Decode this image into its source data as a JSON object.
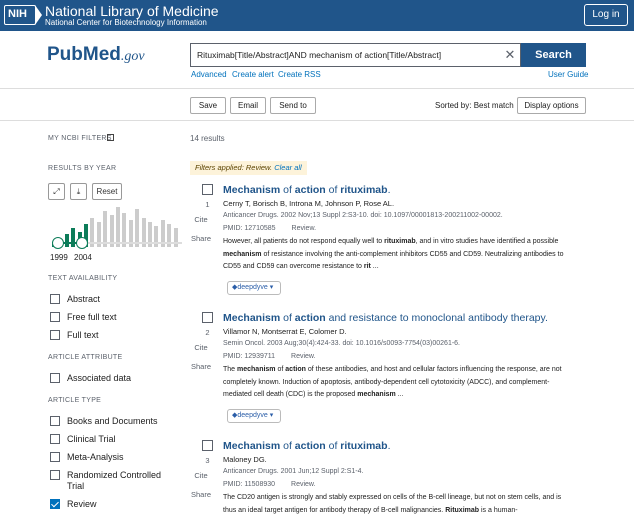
{
  "header": {
    "logo": "NIH",
    "org_name": "National Library of Medicine",
    "org_sub": "National Center for Biotechnology Information",
    "login": "Log in"
  },
  "brand": {
    "pub": "Pub",
    "med": "Med",
    "gov": ".gov"
  },
  "search": {
    "query": "Rituximab[Title/Abstract]AND mechanism of action[Title/Abstract]",
    "button": "Search",
    "clear_icon": "close-icon",
    "links": {
      "advanced": "Advanced",
      "alert": "Create alert",
      "rss": "Create RSS",
      "guide": "User Guide"
    }
  },
  "toolbar": {
    "save": "Save",
    "email": "Email",
    "send_to": "Send to",
    "sorted_by": "Sorted by: Best match",
    "display_options": "Display options"
  },
  "sidebar": {
    "my_filters": "MY NCBI FILTERS",
    "results_by_year": "RESULTS BY YEAR",
    "reset": "Reset",
    "year_start": "1999",
    "year_end": "2004",
    "text_availability": "TEXT AVAILABILITY",
    "text_items": [
      "Abstract",
      "Free full text",
      "Full text"
    ],
    "article_attribute": "ARTICLE ATTRIBUTE",
    "attribute_items": [
      "Associated data"
    ],
    "article_type": "ARTICLE TYPE",
    "type_items": [
      "Books and Documents",
      "Clinical Trial",
      "Meta-Analysis",
      "Randomized Controlled Trial",
      "Review"
    ],
    "checked": "Review",
    "colors": {
      "selected": "#0c7c59",
      "unselected": "#cccccc"
    },
    "histogram": [
      0.1,
      0.15,
      0.3,
      0.45,
      0.35,
      0.55,
      0.7,
      0.6,
      0.85,
      0.75,
      0.95,
      0.8,
      0.65,
      0.9,
      0.7,
      0.6,
      0.5,
      0.65,
      0.55,
      0.45
    ],
    "histogram_selected": [
      0,
      1,
      2,
      3,
      4,
      5
    ]
  },
  "results": {
    "count": "14 results",
    "filters_applied": "Filters applied: Review.",
    "clear_all": "Clear all",
    "cite": "Cite",
    "share": "Share",
    "fulltext_btn": "deepdyve",
    "articles": [
      {
        "num": "1",
        "title_parts": [
          [
            "Mechanism",
            1
          ],
          [
            " of ",
            0
          ],
          [
            "action",
            1
          ],
          [
            " of ",
            0
          ],
          [
            "rituximab",
            1
          ],
          [
            ".",
            0
          ]
        ],
        "authors": "Cerny T, Borisch B, Introna M, Johnson P, Rose AL.",
        "citation": "Anticancer Drugs. 2002 Nov;13 Suppl 2:S3-10. doi: 10.1097/00001813-200211002-00002.",
        "pmid": "PMID: 12710585",
        "type": "Review.",
        "snippet": "However, all patients do not respond equally well to <b>rituximab</b>, and in vitro studies have identified a possible <b>mechanism</b> of resistance involving the anti-complement inhibitors CD55 and CD59. Neutralizing antibodies to CD55 and CD59 can overcome resistance to <b>rit</b> ..."
      },
      {
        "num": "2",
        "title_parts": [
          [
            "Mechanism",
            1
          ],
          [
            " of ",
            0
          ],
          [
            "action",
            1
          ],
          [
            " and resistance to monoclonal antibody therapy.",
            0
          ]
        ],
        "authors": "Villamor N, Montserrat E, Colomer D.",
        "citation": "Semin Oncol. 2003 Aug;30(4):424-33. doi: 10.1016/s0093-7754(03)00261-6.",
        "pmid": "PMID: 12939711",
        "type": "Review.",
        "snippet": "The <b>mechanism</b> of <b>action</b> of these antibodies, and host and cellular factors influencing the response, are not completely known. Induction of apoptosis, antibody-dependent cell cytotoxicity (ADCC), and complement-mediated cell death (CDC) is the proposed <b>mechanism</b> ..."
      },
      {
        "num": "3",
        "title_parts": [
          [
            "Mechanism",
            1
          ],
          [
            " of ",
            0
          ],
          [
            "action",
            1
          ],
          [
            " of ",
            0
          ],
          [
            "rituximab",
            1
          ],
          [
            ".",
            0
          ]
        ],
        "authors": "Maloney DG.",
        "citation": "Anticancer Drugs. 2001 Jun;12 Suppl 2:S1-4.",
        "pmid": "PMID: 11508930",
        "type": "Review.",
        "snippet": "The CD20 antigen is strongly and stably expressed on cells of the B-cell lineage, but not on stem cells, and is thus an ideal target antigen for antibody therapy of B-cell malignancies. <b>Rituximab</b> is a human-"
      }
    ]
  }
}
